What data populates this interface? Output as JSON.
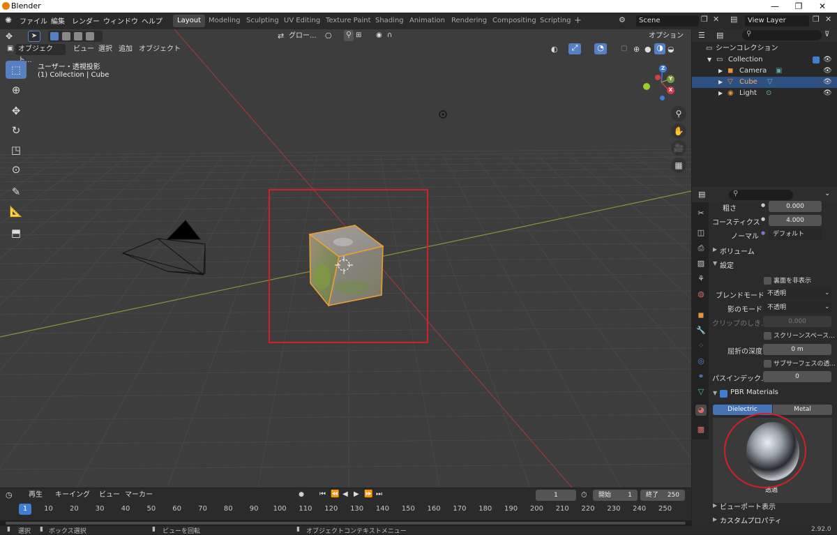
{
  "window": {
    "title": "Blender",
    "minimize": "—",
    "maximize": "❐",
    "close": "✕"
  },
  "topbar": {
    "menus": [
      "ファイル",
      "編集",
      "レンダー",
      "ウィンドウ",
      "ヘルプ"
    ],
    "workspaces": [
      "Layout",
      "Modeling",
      "Sculpting",
      "UV Editing",
      "Texture Paint",
      "Shading",
      "Animation",
      "Rendering",
      "Compositing",
      "Scripting"
    ],
    "active_workspace": "Layout",
    "add_workspace": "+",
    "scene": "Scene",
    "view_layer": "View Layer"
  },
  "viewport": {
    "mode": "オブジェクト...",
    "menus": [
      "ビュー",
      "選択",
      "追加",
      "オブジェクト"
    ],
    "transform_orientation": "グロー...",
    "options": "オプション",
    "overlay_text": {
      "line1": "ユーザー・透視投影",
      "line2": "(1) Collection | Cube"
    },
    "gizmo_labels": {
      "z": "Z",
      "y": "Y",
      "x": "X"
    },
    "accent_color": "#5680c2",
    "highlight_color": "#d41f27"
  },
  "timeline": {
    "menus": [
      "再生",
      "キーイング",
      "ビュー",
      "マーカー"
    ],
    "current_frame": "1",
    "start_label": "開始",
    "start": "1",
    "end_label": "終了",
    "end": "250",
    "ticks": [
      "1",
      "10",
      "20",
      "30",
      "40",
      "50",
      "60",
      "70",
      "80",
      "90",
      "100",
      "110",
      "120",
      "130",
      "140",
      "150",
      "160",
      "170",
      "180",
      "190",
      "200",
      "210",
      "220",
      "230",
      "240",
      "250"
    ],
    "playback_controls": [
      "⏮",
      "⏪",
      "◀",
      "▶",
      "⏩",
      "⏭"
    ]
  },
  "statusbar": {
    "select": "選択",
    "box_select": "ボックス選択",
    "rotate_view": "ビューを回転",
    "context_menu": "オブジェクトコンテキストメニュー",
    "version": "2.92.0"
  },
  "outliner": {
    "root": "シーンコレクション",
    "collection": "Collection",
    "items": [
      {
        "name": "Camera",
        "icon": "camera-icon",
        "selected": false
      },
      {
        "name": "Cube",
        "icon": "mesh-icon",
        "selected": true
      },
      {
        "name": "Light",
        "icon": "light-icon",
        "selected": false
      }
    ]
  },
  "properties": {
    "roughness_label": "粗さ",
    "roughness": "0.000",
    "coarse_label": "コースティクス",
    "coarse": "4.000",
    "normal_label": "ノーマル",
    "normal": "デフォルト",
    "volume": "ボリューム",
    "settings": "設定",
    "backface": "裏面を非表示",
    "blend_label": "ブレンドモード",
    "blend": "不透明",
    "shadow_label": "影のモード",
    "shadow": "不透明",
    "clip_label": "クリップのしき...",
    "clip": "0.000",
    "screenspace": "スクリーンスペース...",
    "refract_label": "屈折の深度",
    "refract": "0 m",
    "subsurface": "サブサーフェスの透...",
    "passindex_label": "パスインデック...",
    "passindex": "0",
    "pbr_title": "PBR Materials",
    "tab_dielectric": "Dielectric",
    "tab_metal": "Metal",
    "preview_label": "透過",
    "viewport_display": "ビューポート表示",
    "custom_props": "カスタムプロパティ"
  }
}
